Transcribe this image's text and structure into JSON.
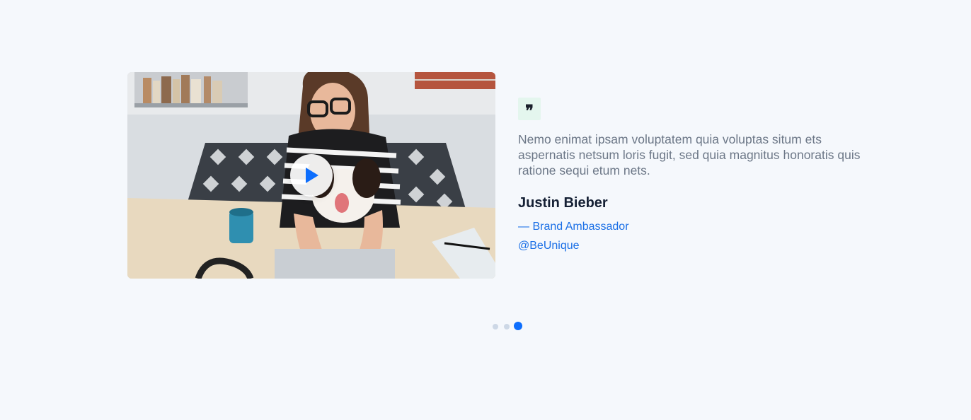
{
  "testimonial": {
    "quote_mark": "❞",
    "text": "Nemo enimat ipsam voluptatem quia voluptas situm ets aspernatis netsum loris fugit, sed quia magnitus honoratis quis ratione sequi etum nets.",
    "author_name": "Justin Bieber",
    "author_role": "— Brand Ambassador",
    "author_handle": "@BeUnique"
  },
  "media": {
    "play_icon": "play-icon",
    "image_description_icon": "photo"
  },
  "carousel": {
    "slide_count": 3,
    "active_index": 3
  },
  "colors": {
    "background": "#f5f8fc",
    "accent": "#1a6fe6",
    "active_dot": "#0d6efd",
    "inactive_dot": "#cdd8e6",
    "quote_badge": "#e4f6ee"
  }
}
